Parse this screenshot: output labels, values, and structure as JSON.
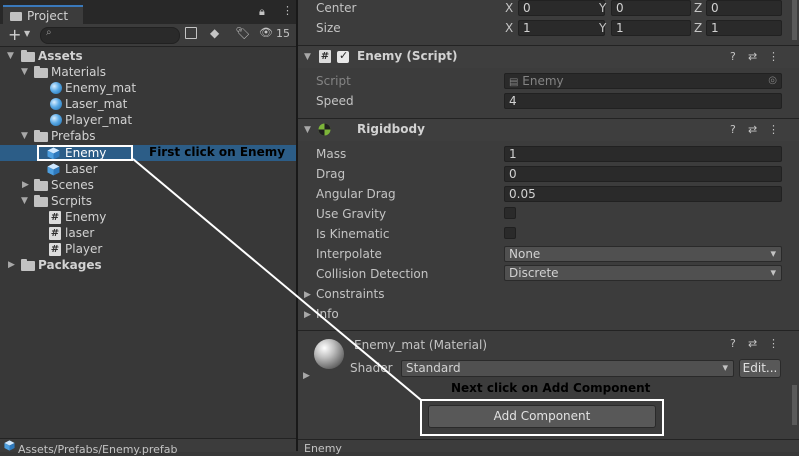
{
  "project_panel": {
    "tab_label": "Project",
    "hidden_count": "15",
    "tree": [
      {
        "label": "Assets",
        "icon": "folder-icon",
        "bold": true
      },
      {
        "label": "Materials",
        "icon": "folder-icon"
      },
      {
        "label": "Enemy_mat",
        "icon": "material-icon"
      },
      {
        "label": "Laser_mat",
        "icon": "material-icon"
      },
      {
        "label": "Player_mat",
        "icon": "material-icon"
      },
      {
        "label": "Prefabs",
        "icon": "folder-icon"
      },
      {
        "label": "Enemy",
        "icon": "prefab-icon",
        "selected": true
      },
      {
        "label": "Laser",
        "icon": "prefab-icon"
      },
      {
        "label": "Scenes",
        "icon": "folder-icon"
      },
      {
        "label": "Scrpits",
        "icon": "folder-icon"
      },
      {
        "label": "Enemy",
        "icon": "script-icon"
      },
      {
        "label": "laser",
        "icon": "script-icon"
      },
      {
        "label": "Player",
        "icon": "script-icon"
      },
      {
        "label": "Packages",
        "icon": "folder-icon",
        "bold": true
      }
    ],
    "footer_path": "Assets/Prefabs/Enemy.prefab"
  },
  "inspector": {
    "collider": {
      "center_label": "Center",
      "size_label": "Size",
      "axis_x": "X",
      "axis_y": "Y",
      "axis_z": "Z",
      "center": {
        "x": "0",
        "y": "0",
        "z": "0"
      },
      "size": {
        "x": "1",
        "y": "1",
        "z": "1"
      }
    },
    "script_component": {
      "title": "Enemy (Script)",
      "script_label": "Script",
      "script_value": "Enemy",
      "speed_label": "Speed",
      "speed_value": "4"
    },
    "rigidbody": {
      "title": "Rigidbody",
      "mass_label": "Mass",
      "mass_value": "1",
      "drag_label": "Drag",
      "drag_value": "0",
      "angular_drag_label": "Angular Drag",
      "angular_drag_value": "0.05",
      "use_gravity_label": "Use Gravity",
      "is_kinematic_label": "Is Kinematic",
      "interpolate_label": "Interpolate",
      "interpolate_value": "None",
      "collision_label": "Collision Detection",
      "collision_value": "Discrete",
      "constraints_label": "Constraints",
      "info_label": "Info"
    },
    "material": {
      "title": "Enemy_mat (Material)",
      "shader_label": "Shader",
      "shader_value": "Standard",
      "edit_label": "Edit..."
    },
    "add_component_label": "Add Component",
    "footer_label": "Enemy"
  },
  "annotations": {
    "first": "First click on Enemy",
    "next": "Next click on Add Component",
    "color": "#000000",
    "highlight_color": "#ffffff"
  },
  "colors": {
    "selection": "#2c5d87",
    "panel_bg": "#383838",
    "inspector_bg": "#3c3c3c",
    "tab_accent": "#3a79bb"
  }
}
